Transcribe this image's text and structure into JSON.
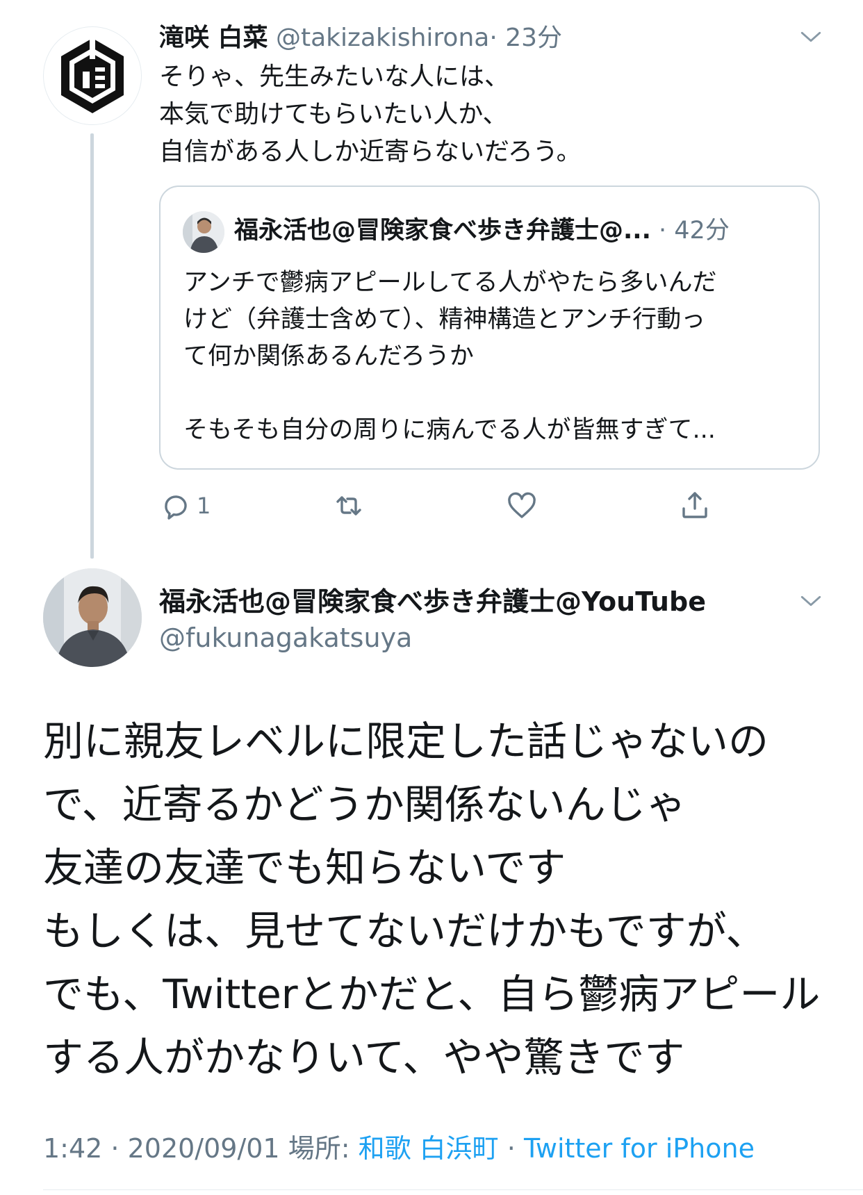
{
  "parent_tweet": {
    "display_name": "滝咲 白菜",
    "handle": "@takizakishirona",
    "separator": "·",
    "time": "23分",
    "text": "そりゃ、先生みたいな人には、\n本気で助けてもらいたい人か、\n自信がある人しか近寄らないだろう。",
    "quoted": {
      "display_name": "福永活也@冒険家食べ歩き弁護士@...",
      "time": "· 42分",
      "text": "アンチで鬱病アピールしてる人がやたら多いんだ\nけど（弁護士含めて）、精神構造とアンチ行動っ\nて何か関係あるんだろうか\n\nそもそも自分の周りに病んでる人が皆無すぎて..."
    },
    "actions": {
      "reply_count": "1"
    }
  },
  "main_tweet": {
    "display_name": "福永活也@冒険家食べ歩き弁護士@YouTube",
    "handle": "@fukunagakatsuya",
    "text": "別に親友レベルに限定した話じゃないの\nで、近寄るかどうか関係ないんじゃ\n友達の友達でも知らないです\nもしくは、見せてないだけかもですが、\nでも、Twitterとかだと、自ら鬱病アピール\nする人がかなりいて、やや驚きです",
    "meta": {
      "time": "1:42",
      "sep1": " · ",
      "date": "2020/09/01",
      "location_label": " 場所: ",
      "location": "和歌 白浜町",
      "sep2": " · ",
      "source": "Twitter for iPhone"
    }
  },
  "colors": {
    "accent": "#1da1f2",
    "secondary_text": "#657786",
    "border": "#ccd6dd"
  }
}
